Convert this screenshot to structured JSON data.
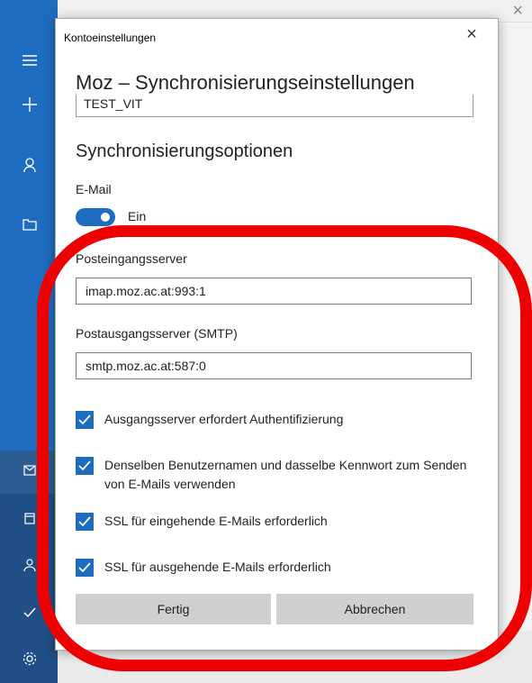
{
  "dialog": {
    "title": "Kontoeinstellungen",
    "close_glyph": "×",
    "heading": "Moz – Synchronisierungseinstellungen",
    "account_name": "TEST_VIT"
  },
  "sync": {
    "section_title": "Synchronisierungsoptionen",
    "email_label": "E-Mail",
    "email_toggle_state": "Ein"
  },
  "incoming": {
    "label": "Posteingangsserver",
    "value": "imap.moz.ac.at:993:1"
  },
  "outgoing": {
    "label": "Postausgangsserver (SMTP)",
    "value": "smtp.moz.ac.at:587:0"
  },
  "checkboxes": [
    {
      "label": "Ausgangsserver erfordert Authentifizierung",
      "checked": true
    },
    {
      "label": "Denselben Benutzernamen und dasselbe Kennwort zum Senden von E-Mails verwenden",
      "checked": true
    },
    {
      "label": "SSL für eingehende E-Mails erforderlich",
      "checked": true
    },
    {
      "label": "SSL für ausgehende E-Mails erforderlich",
      "checked": true
    }
  ],
  "buttons": {
    "done": "Fertig",
    "cancel": "Abbrechen"
  },
  "sidebar_icons": [
    "hamburger-icon",
    "plus-icon",
    "person-icon",
    "folder-icon",
    "mail-icon",
    "calendar-icon",
    "people-icon",
    "todo-icon",
    "gear-icon"
  ],
  "colors": {
    "accent": "#1e6cc0",
    "sidebar_dark": "#1f4f86",
    "annotation_ring": "#ef0000",
    "button_bg": "#cfcfcf"
  }
}
